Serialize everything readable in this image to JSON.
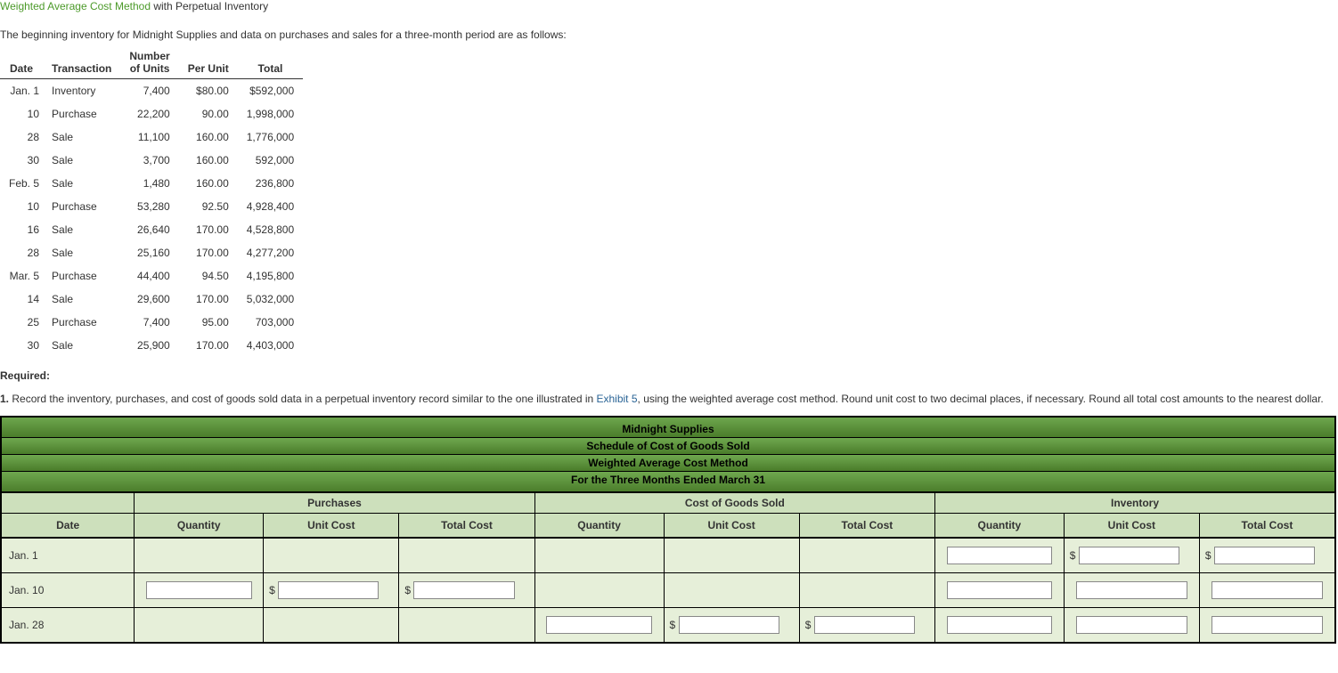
{
  "title": {
    "link_text": "Weighted Average Cost Method",
    "rest": " with Perpetual Inventory"
  },
  "intro": "The beginning inventory for Midnight Supplies and data on purchases and sales for a three-month period are as follows:",
  "data_table": {
    "headers": {
      "date": "Date",
      "transaction": "Transaction",
      "units_line1": "Number",
      "units_line2": "of Units",
      "per_unit": "Per Unit",
      "total": "Total"
    },
    "rows": [
      {
        "date": "Jan. 1",
        "txn": "Inventory",
        "units": "7,400",
        "per": "$80.00",
        "total": "$592,000"
      },
      {
        "date": "10",
        "txn": "Purchase",
        "units": "22,200",
        "per": "90.00",
        "total": "1,998,000"
      },
      {
        "date": "28",
        "txn": "Sale",
        "units": "11,100",
        "per": "160.00",
        "total": "1,776,000"
      },
      {
        "date": "30",
        "txn": "Sale",
        "units": "3,700",
        "per": "160.00",
        "total": "592,000"
      },
      {
        "date": "Feb. 5",
        "txn": "Sale",
        "units": "1,480",
        "per": "160.00",
        "total": "236,800"
      },
      {
        "date": "10",
        "txn": "Purchase",
        "units": "53,280",
        "per": "92.50",
        "total": "4,928,400"
      },
      {
        "date": "16",
        "txn": "Sale",
        "units": "26,640",
        "per": "170.00",
        "total": "4,528,800"
      },
      {
        "date": "28",
        "txn": "Sale",
        "units": "25,160",
        "per": "170.00",
        "total": "4,277,200"
      },
      {
        "date": "Mar. 5",
        "txn": "Purchase",
        "units": "44,400",
        "per": "94.50",
        "total": "4,195,800"
      },
      {
        "date": "14",
        "txn": "Sale",
        "units": "29,600",
        "per": "170.00",
        "total": "5,032,000"
      },
      {
        "date": "25",
        "txn": "Purchase",
        "units": "7,400",
        "per": "95.00",
        "total": "703,000"
      },
      {
        "date": "30",
        "txn": "Sale",
        "units": "25,900",
        "per": "170.00",
        "total": "4,403,000"
      }
    ]
  },
  "required_label": "Required:",
  "question": {
    "num": "1.",
    "text_before": " Record the inventory, purchases, and cost of goods sold data in a perpetual inventory record similar to the one illustrated in ",
    "exhibit": "Exhibit 5",
    "text_after": ", using the weighted average cost method. Round unit cost to two decimal places, if necessary. Round all total cost amounts to the nearest dollar."
  },
  "schedule": {
    "titles": [
      "Midnight Supplies",
      "Schedule of Cost of Goods Sold",
      "Weighted Average Cost Method",
      "For the Three Months Ended March 31"
    ],
    "groups": {
      "purchases": "Purchases",
      "cogs": "Cost of Goods Sold",
      "inventory": "Inventory"
    },
    "cols": {
      "date": "Date",
      "qty": "Quantity",
      "unit": "Unit Cost",
      "total": "Total Cost"
    },
    "dollar": "$",
    "rows": [
      {
        "date": "Jan. 1",
        "cells": {
          "p_qty": false,
          "p_unit": false,
          "p_tot": false,
          "c_qty": false,
          "c_unit": false,
          "c_tot": false,
          "i_qty": true,
          "i_unit": "$",
          "i_tot": "$"
        }
      },
      {
        "date": "Jan. 10",
        "cells": {
          "p_qty": true,
          "p_unit": "$",
          "p_tot": "$",
          "c_qty": false,
          "c_unit": false,
          "c_tot": false,
          "i_qty": true,
          "i_unit": true,
          "i_tot": true
        }
      },
      {
        "date": "Jan. 28",
        "cells": {
          "p_qty": false,
          "p_unit": false,
          "p_tot": false,
          "c_qty": true,
          "c_unit": "$",
          "c_tot": "$",
          "i_qty": true,
          "i_unit": true,
          "i_tot": true
        }
      }
    ]
  }
}
